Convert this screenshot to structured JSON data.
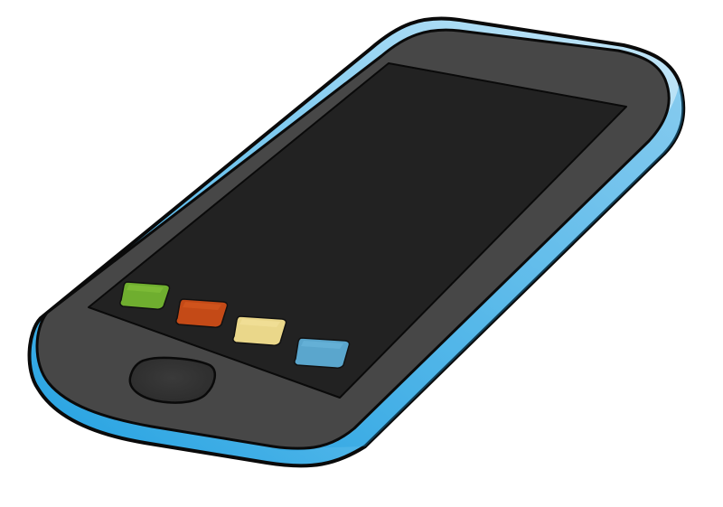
{
  "scene": {
    "subject": "smartphone-clipart"
  },
  "colors": {
    "background": "#ffffff",
    "case_light": "#c9e8f8",
    "case_mid": "#6cc3ee",
    "case_dark": "#1f9fe0",
    "outline": "#0a0a0a",
    "bezel": "#474747",
    "screen": "#222222",
    "home_button": "#2c2c2c",
    "home_button_highlight": "#3a3a3a"
  },
  "app_icons": [
    {
      "name": "green-app-icon",
      "color": "#6fae2f",
      "highlight": "#86c23c"
    },
    {
      "name": "orange-app-icon",
      "color": "#c44a17",
      "highlight": "#d95a20"
    },
    {
      "name": "yellow-app-icon",
      "color": "#ead78a",
      "highlight": "#f3e39c"
    },
    {
      "name": "blue-app-icon",
      "color": "#5aa6cd",
      "highlight": "#6bb7dc"
    }
  ],
  "icons": {
    "home_button": "home-button-icon"
  }
}
